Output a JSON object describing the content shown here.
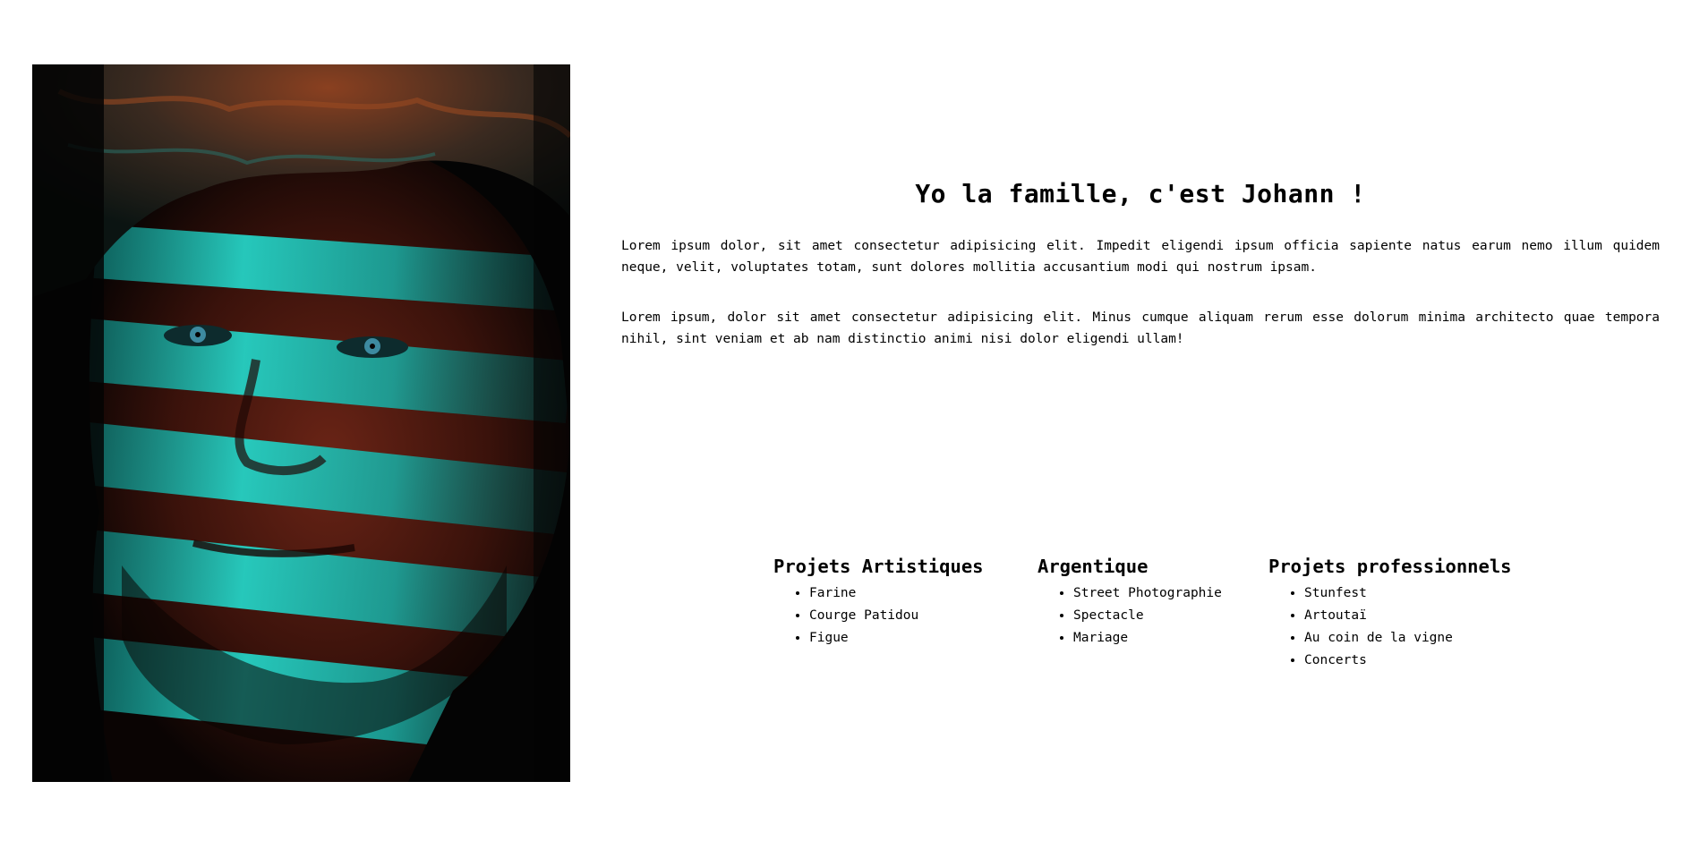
{
  "portrait": {
    "icon": "portrait-photo",
    "colors": {
      "teal": "#1fbfb5",
      "rust": "#5a1d12",
      "hair": "#7a3a1c",
      "shadow": "#050505"
    }
  },
  "intro": {
    "title": "Yo la famille, c'est Johann !",
    "paragraph_1": "Lorem ipsum dolor, sit amet consectetur adipisicing elit. Impedit eligendi ipsum officia sapiente natus earum nemo illum quidem neque, velit, voluptates totam, sunt dolores mollitia accusantium modi qui nostrum ipsam.",
    "paragraph_2": "Lorem ipsum, dolor sit amet consectetur adipisicing elit. Minus cumque aliquam rerum esse dolorum minima architecto quae tempora nihil, sint veniam et ab nam distinctio animi nisi dolor eligendi ullam!"
  },
  "projects": [
    {
      "title": "Projets Artistiques",
      "items": [
        "Farine",
        "Courge Patidou",
        "Figue"
      ]
    },
    {
      "title": "Argentique",
      "items": [
        "Street Photographie",
        "Spectacle",
        "Mariage"
      ]
    },
    {
      "title": "Projets professionnels",
      "items": [
        "Stunfest",
        "Artoutaï",
        "Au coin de la vigne",
        "Concerts"
      ]
    }
  ]
}
